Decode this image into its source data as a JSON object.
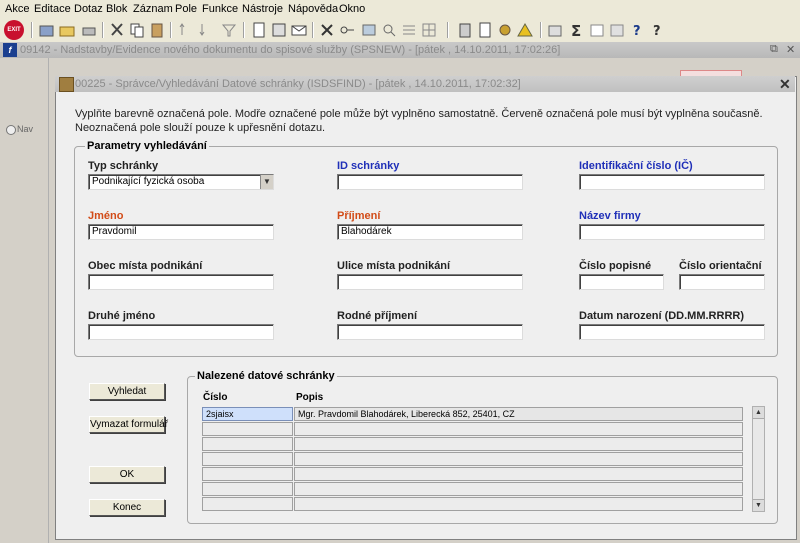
{
  "menu": [
    "Akce",
    "Editace",
    "Dotaz",
    "Blok",
    "Záznam",
    "Pole",
    "Funkce",
    "Nástroje",
    "Nápověda",
    "Okno"
  ],
  "toolbar": {
    "exit_label": "EXIT"
  },
  "outer_window": {
    "title": "09142 - Nadstavby/Evidence nového dokumentu do spisové služby (SPSNEW) - [pátek , 14.10.2011, 17:02:26]",
    "nav_label": "Nav"
  },
  "dialog": {
    "title": "00225 - Správce/Vyhledávání Datové schránky (ISDSFIND) - [pátek , 14.10.2011, 17:02:32]",
    "instruction_line1": "Vyplňte barevně označená pole. Modře označené pole může být vyplněno samostatně. Červeně označená pole musí být vyplněna současně.",
    "instruction_line2": "Neoznačená pole slouží pouze k upřesnění dotazu."
  },
  "params": {
    "group_label": "Parametry vyhledávání",
    "typ_schranky_label": "Typ schránky",
    "typ_schranky_value": "Podnikající fyzická osoba",
    "id_schranky_label": "ID schránky",
    "id_schranky_value": "",
    "ic_label": "Identifikační číslo (IČ)",
    "ic_value": "",
    "jmeno_label": "Jméno",
    "jmeno_value": "Pravdomil",
    "prijmeni_label": "Příjmení",
    "prijmeni_value": "Blahodárek",
    "nazev_firmy_label": "Název firmy",
    "nazev_firmy_value": "",
    "obec_label": "Obec místa podnikání",
    "obec_value": "",
    "ulice_label": "Ulice místa podnikání",
    "ulice_value": "",
    "cislo_popisne_label": "Číslo popisné",
    "cislo_popisne_value": "",
    "cislo_orientacni_label": "Číslo orientační",
    "cislo_orientacni_value": "",
    "druhe_jmeno_label": "Druhé jméno",
    "druhe_jmeno_value": "",
    "rodne_prijmeni_label": "Rodné příjmení",
    "rodne_prijmeni_value": "",
    "datum_narozeni_label": "Datum narození (DD.MM.RRRR)",
    "datum_narozeni_value": ""
  },
  "buttons": {
    "vyhledat": "Vyhledat",
    "vymazat": "Vymazat formulář",
    "ok": "OK",
    "konec": "Konec"
  },
  "results": {
    "group_label": "Nalezené datové schránky",
    "col_cislo": "Číslo",
    "col_popis": "Popis",
    "rows": [
      {
        "cislo": "2sjaisx",
        "popis": "Mgr. Pravdomil Blahodárek, Liberecká 852, 25401, CZ"
      },
      {
        "cislo": "",
        "popis": ""
      },
      {
        "cislo": "",
        "popis": ""
      },
      {
        "cislo": "",
        "popis": ""
      },
      {
        "cislo": "",
        "popis": ""
      },
      {
        "cislo": "",
        "popis": ""
      },
      {
        "cislo": "",
        "popis": ""
      }
    ]
  },
  "colors": {
    "blue_label": "#1f2fb8",
    "red_label": "#d24b17",
    "selected_row": "#cfe0fb"
  }
}
